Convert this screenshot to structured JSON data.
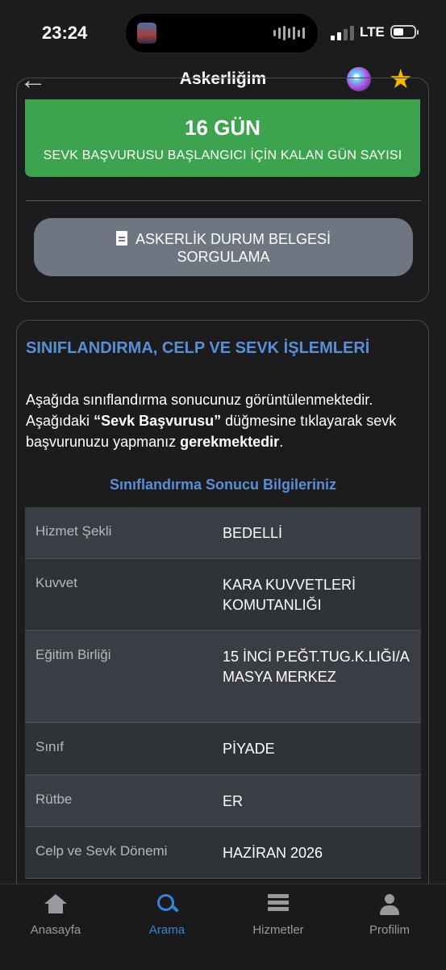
{
  "status_bar": {
    "time": "23:24",
    "network": "LTE"
  },
  "header": {
    "title": "Askerliğim",
    "back_icon": "arrow-left-icon",
    "siri_icon": "siri-icon",
    "star_icon": "star-icon"
  },
  "countdown": {
    "days": "16 GÜN",
    "label": "SEVK BAŞVURUSU BAŞLANGICI İÇİN KALAN GÜN SAYISI"
  },
  "document_button": {
    "line1": "ASKERLİK DURUM BELGESİ",
    "line2": "SORGULAMA",
    "icon": "document-icon"
  },
  "section": {
    "title": "SINIFLANDIRMA, CELP VE SEVK İŞLEMLERİ",
    "paragraph": {
      "part1": "Aşağıda sınıflandırma sonucunuz görüntülenmektedir. Aşağıdaki ",
      "bold1": "“Sevk Başvurusu”",
      "part2": " düğmesine tıklayarak sevk başvurunuzu yapmanız ",
      "bold2": "gerekmektedir",
      "part3": "."
    },
    "subtitle": "Sınıflandırma Sonucu Bilgileriniz"
  },
  "table": [
    {
      "key": "Hizmet Şekli",
      "value": "BEDELLİ"
    },
    {
      "key": "Kuvvet",
      "value": "KARA KUVVETLERİ KOMUTANLIĞI"
    },
    {
      "key": "Eğitim Birliği",
      "value": "15 İNCİ P.EĞT.TUG.K.LIĞI/AMASYA MERKEZ"
    },
    {
      "key": "Sınıf",
      "value": "PİYADE"
    },
    {
      "key": "Rütbe",
      "value": "ER"
    },
    {
      "key": "Celp ve Sevk Dönemi",
      "value": "HAZİRAN 2026"
    }
  ],
  "tabbar": [
    {
      "label": "Anasayfa",
      "icon": "home-icon"
    },
    {
      "label": "Arama",
      "icon": "search-icon"
    },
    {
      "label": "Hizmetler",
      "icon": "list-icon"
    },
    {
      "label": "Profilim",
      "icon": "user-icon"
    }
  ],
  "colors": {
    "accent": "#3b82d6",
    "success": "#3ea34f",
    "section_title": "#5a8fd6"
  }
}
